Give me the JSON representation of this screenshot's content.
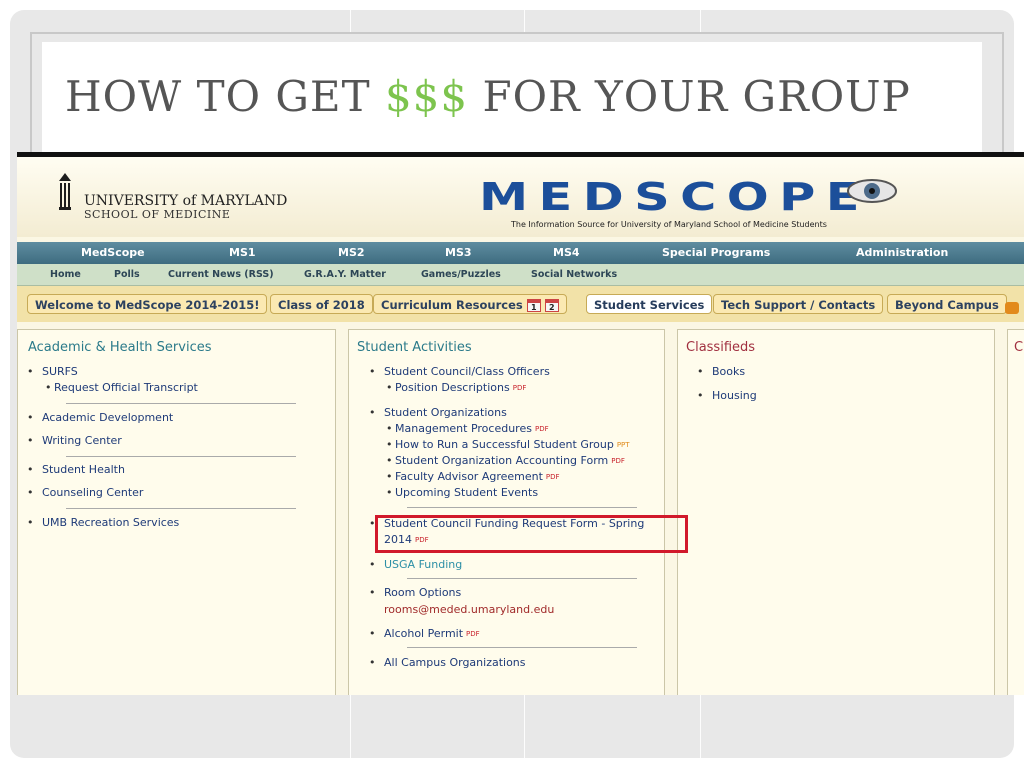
{
  "slide": {
    "title_pre": "HOW TO GET ",
    "title_money": "$$$",
    "title_post": " FOR YOUR GROUP"
  },
  "colors": {
    "money": "#7dc44e",
    "title": "#555555",
    "highlight": "#d1192b",
    "nav_bar": "#4a7a8e"
  },
  "header": {
    "university_line1": "UNIVERSITY of MARYLAND",
    "university_line2": "SCHOOL OF MEDICINE",
    "logo_text": "MEDSCOPE",
    "tagline": "The Information Source for University of Maryland School of Medicine Students"
  },
  "nav_main": [
    "MedScope",
    "MS1",
    "MS2",
    "MS3",
    "MS4",
    "Special Programs",
    "Administration"
  ],
  "nav_sub": [
    "Home",
    "Polls",
    "Current News (RSS)",
    "G.R.A.Y. Matter",
    "Games/Puzzles",
    "Social Networks"
  ],
  "tabs": {
    "welcome": "Welcome to MedScope 2014-2015!",
    "class": "Class of 2018",
    "curriculum": "Curriculum Resources",
    "cal1": "1",
    "cal2": "2",
    "student_services": "Student Services",
    "tech": "Tech Support / Contacts",
    "beyond": "Beyond Campus"
  },
  "academic": {
    "heading": "Academic & Health Services",
    "items": [
      "SURFS",
      "Request Official Transcript",
      "Academic Development",
      "Writing Center",
      "Student Health",
      "Counseling Center",
      "UMB Recreation Services"
    ]
  },
  "activities": {
    "heading": "Student Activities",
    "council": "Student Council/Class Officers",
    "position_desc": "Position Descriptions",
    "orgs": "Student Organizations",
    "mgmt": "Management Procedures",
    "howto": "How to Run a Successful Student Group",
    "accounting": "Student Organization Accounting Form",
    "advisor": "Faculty Advisor Agreement",
    "events": "Upcoming Student Events",
    "funding_line1": "Student Council Funding Request Form - Spring",
    "funding_line2": "2014",
    "usga": "USGA Funding",
    "room": "Room Options",
    "room_email": "rooms@meded.umaryland.edu",
    "alcohol": "Alcohol Permit",
    "campus": "All Campus Organizations",
    "pdf": "PDF",
    "ppt": "PPT"
  },
  "classifieds": {
    "heading": "Classifieds",
    "items": [
      "Books",
      "Housing"
    ]
  },
  "cut_heading": "C"
}
